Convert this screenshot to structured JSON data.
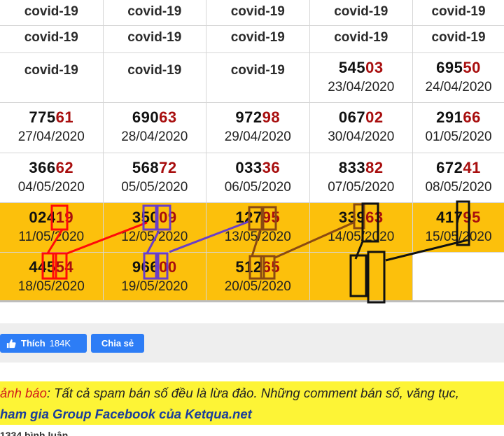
{
  "table": {
    "rows": [
      [
        {
          "label": "covid-19"
        },
        {
          "label": "covid-19"
        },
        {
          "label": "covid-19"
        },
        {
          "label": "covid-19"
        },
        {
          "label": "covid-19"
        }
      ],
      [
        {
          "label": "covid-19"
        },
        {
          "label": "covid-19"
        },
        {
          "label": "covid-19"
        },
        {
          "label": "covid-19"
        },
        {
          "label": "covid-19"
        }
      ],
      [
        {
          "label": "covid-19"
        },
        {
          "label": "covid-19"
        },
        {
          "label": "covid-19"
        },
        {
          "prefix": "545",
          "suffix": "03",
          "date": "23/04/2020"
        },
        {
          "prefix": "695",
          "suffix": "50",
          "date": "24/04/2020"
        }
      ],
      [
        {
          "prefix": "775",
          "suffix": "61",
          "date": "27/04/2020"
        },
        {
          "prefix": "690",
          "suffix": "63",
          "date": "28/04/2020"
        },
        {
          "prefix": "972",
          "suffix": "98",
          "date": "29/04/2020"
        },
        {
          "prefix": "067",
          "suffix": "02",
          "date": "30/04/2020"
        },
        {
          "prefix": "291",
          "suffix": "66",
          "date": "01/05/2020"
        }
      ],
      [
        {
          "prefix": "366",
          "suffix": "62",
          "date": "04/05/2020"
        },
        {
          "prefix": "568",
          "suffix": "72",
          "date": "05/05/2020"
        },
        {
          "prefix": "033",
          "suffix": "36",
          "date": "06/05/2020"
        },
        {
          "prefix": "833",
          "suffix": "82",
          "date": "07/05/2020"
        },
        {
          "prefix": "672",
          "suffix": "41",
          "date": "08/05/2020"
        }
      ],
      [
        {
          "prefix": "024",
          "suffix": "19",
          "date": "11/05/2020"
        },
        {
          "prefix": "350",
          "suffix": "09",
          "date": "12/05/2020"
        },
        {
          "prefix": "127",
          "suffix": "95",
          "date": "13/05/2020"
        },
        {
          "prefix": "339",
          "suffix": "63",
          "date": "14/05/2020"
        },
        {
          "prefix": "417",
          "suffix": "95",
          "date": "15/05/2020"
        }
      ],
      [
        {
          "prefix": "445",
          "suffix": "54",
          "date": "18/05/2020"
        },
        {
          "prefix": "966",
          "suffix": "00",
          "date": "19/05/2020"
        },
        {
          "prefix": "512",
          "suffix": "65",
          "date": "20/05/2020"
        },
        {},
        {}
      ]
    ]
  },
  "social": {
    "like_label": "Thích",
    "like_count": "184K",
    "share_label": "Chia sẻ"
  },
  "warning": {
    "lead": "ảnh báo",
    "text": ": Tất cả spam bán số đều là lừa đảo. Những comment bán số, văng tục,",
    "link": "ham gia Group Facebook của Ketqua.net"
  },
  "footer": {
    "partial": "1334 bình luận"
  },
  "colors": {
    "gold": "#fcc00c",
    "highlight": "#a80e0e",
    "fb_blue": "#2d7df6",
    "warning_bg": "#fdf436"
  }
}
